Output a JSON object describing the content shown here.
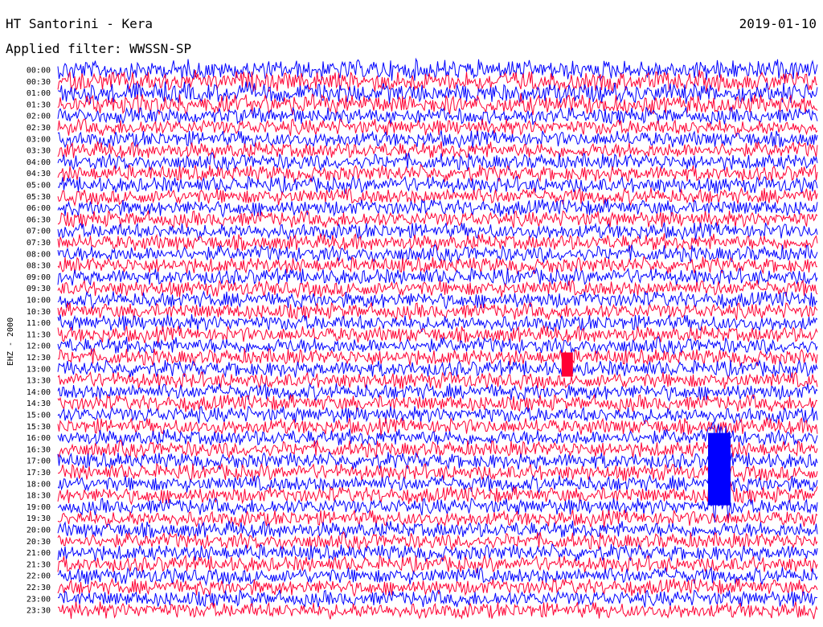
{
  "header": {
    "title": "HT Santorini - Kera",
    "date": "2019-01-10",
    "filter_label": "Applied filter: WWSSN-SP"
  },
  "chart_data": {
    "type": "line",
    "title": "HT Santorini - Kera",
    "subtitle": "Applied filter: WWSSN-SP",
    "date": "2019-01-10",
    "ylabel": "EHZ - 2000",
    "xlabel": "",
    "row_interval_minutes": 30,
    "rows": [
      "00:00",
      "00:30",
      "01:00",
      "01:30",
      "02:00",
      "02:30",
      "03:00",
      "03:30",
      "04:00",
      "04:30",
      "05:00",
      "05:30",
      "06:00",
      "06:30",
      "07:00",
      "07:30",
      "08:00",
      "08:30",
      "09:00",
      "09:30",
      "10:00",
      "10:30",
      "11:00",
      "11:30",
      "12:00",
      "12:30",
      "13:00",
      "13:30",
      "14:00",
      "14:30",
      "15:00",
      "15:30",
      "16:00",
      "16:30",
      "17:00",
      "17:30",
      "18:00",
      "18:30",
      "19:00",
      "19:30",
      "20:00",
      "20:30",
      "21:00",
      "21:30",
      "22:00",
      "22:30",
      "23:00",
      "23:30"
    ],
    "series_colors": [
      "#0000ff",
      "#ff0033"
    ],
    "grid": false,
    "events": [
      {
        "row": "12:30",
        "fraction": 0.67,
        "color": "#ff0033",
        "amplitude": 0.9
      },
      {
        "row": "16:00",
        "fraction": 0.87,
        "color": "#0000ff",
        "amplitude": 2.2
      }
    ]
  }
}
